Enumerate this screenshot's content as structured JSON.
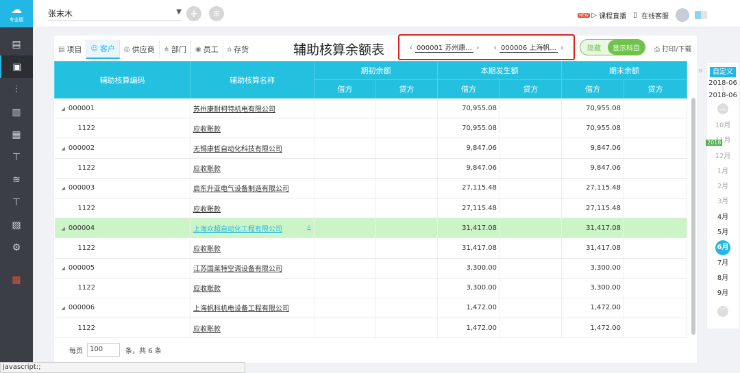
{
  "app": {
    "edition": "专业版"
  },
  "sidebar": {
    "items": [
      {
        "icon": "ledger-icon"
      },
      {
        "icon": "voucher-icon"
      },
      {
        "icon": "chart-icon"
      },
      {
        "icon": "report-icon"
      },
      {
        "icon": "calendar-icon"
      },
      {
        "icon": "tax-icon"
      },
      {
        "icon": "stack-icon"
      },
      {
        "icon": "asset-icon"
      },
      {
        "icon": "document-icon"
      },
      {
        "icon": "settings-icon"
      },
      {
        "icon": "gift-icon"
      }
    ]
  },
  "topbar": {
    "company": "张末木",
    "live_badge": "NEW",
    "live_course": "课程直播",
    "online_service": "在线客服"
  },
  "tabs": [
    {
      "label": "项目",
      "icon": "list-icon"
    },
    {
      "label": "客户",
      "icon": "customer-icon",
      "active": true
    },
    {
      "label": "供应商",
      "icon": "supplier-icon"
    },
    {
      "label": "部门",
      "icon": "department-icon"
    },
    {
      "label": "员工",
      "icon": "employee-icon"
    },
    {
      "label": "存货",
      "icon": "inventory-icon"
    }
  ],
  "page_title": "辅助核算余额表",
  "range": {
    "from": "000001  苏州康...",
    "to": "000006  上海帆..."
  },
  "toggle": {
    "off_label": "隐藏",
    "on_label": "显示科目"
  },
  "print_label": "打印/下载",
  "columns": {
    "code": "辅助核算编码",
    "name": "辅助核算名称",
    "opening": "期初余额",
    "period": "本期发生额",
    "closing": "期末余额",
    "debit": "借方",
    "credit": "贷方"
  },
  "rows": [
    {
      "code": "000001",
      "name": "苏州康耐柯特机电有限公司",
      "parent": true,
      "period_debit": "70,955.08",
      "closing_debit": "70,955.08"
    },
    {
      "code": "1122",
      "name": "应收账款",
      "parent": false,
      "period_debit": "70,955.08",
      "closing_debit": "70,955.08"
    },
    {
      "code": "000002",
      "name": "无锡康哲自动化科技有限公司",
      "parent": true,
      "period_debit": "9,847.06",
      "closing_debit": "9,847.06"
    },
    {
      "code": "1122",
      "name": "应收账款",
      "parent": false,
      "period_debit": "9,847.06",
      "closing_debit": "9,847.06"
    },
    {
      "code": "000003",
      "name": "启东升亚电气设备制造有限公司",
      "parent": true,
      "period_debit": "27,115.48",
      "closing_debit": "27,115.48"
    },
    {
      "code": "1122",
      "name": "应收账款",
      "parent": false,
      "period_debit": "27,115.48",
      "closing_debit": "27,115.48"
    },
    {
      "code": "000004",
      "name": "上海众超自动化工程有限公司",
      "parent": true,
      "highlight": true,
      "period_debit": "31,417.08",
      "closing_debit": "31,417.08"
    },
    {
      "code": "1122",
      "name": "应收账款",
      "parent": false,
      "period_debit": "31,417.08",
      "closing_debit": "31,417.08"
    },
    {
      "code": "000005",
      "name": "江苏国莱特空调设备有限公司",
      "parent": true,
      "period_debit": "3,300.00",
      "closing_debit": "3,300.00"
    },
    {
      "code": "1122",
      "name": "应收账款",
      "parent": false,
      "period_debit": "3,300.00",
      "closing_debit": "3,300.00"
    },
    {
      "code": "000006",
      "name": "上海帆科机电设备工程有限公司",
      "parent": true,
      "period_debit": "1,472.00",
      "closing_debit": "1,472.00"
    },
    {
      "code": "1122",
      "name": "应收账款",
      "parent": false,
      "period_debit": "1,472.00",
      "closing_debit": "1,472.00"
    }
  ],
  "pager": {
    "prefix": "每页",
    "page_size": "100",
    "suffix": "条，共 6 条"
  },
  "date_rail": {
    "custom": "自定义",
    "start": "2018-06",
    "end": "2018-06",
    "year": "2018",
    "months": [
      {
        "label": "10月",
        "state": "future"
      },
      {
        "label": "11月",
        "state": "future",
        "year_badge": true
      },
      {
        "label": "12月",
        "state": "future"
      },
      {
        "label": "1月",
        "state": "future"
      },
      {
        "label": "2月",
        "state": "future"
      },
      {
        "label": "3月",
        "state": "future"
      },
      {
        "label": "4月",
        "state": "past"
      },
      {
        "label": "5月",
        "state": "past"
      },
      {
        "label": "6月",
        "state": "active"
      },
      {
        "label": "7月",
        "state": "past"
      },
      {
        "label": "8月",
        "state": "past"
      },
      {
        "label": "9月",
        "state": "past"
      }
    ]
  },
  "status_bar": "javascript:;"
}
